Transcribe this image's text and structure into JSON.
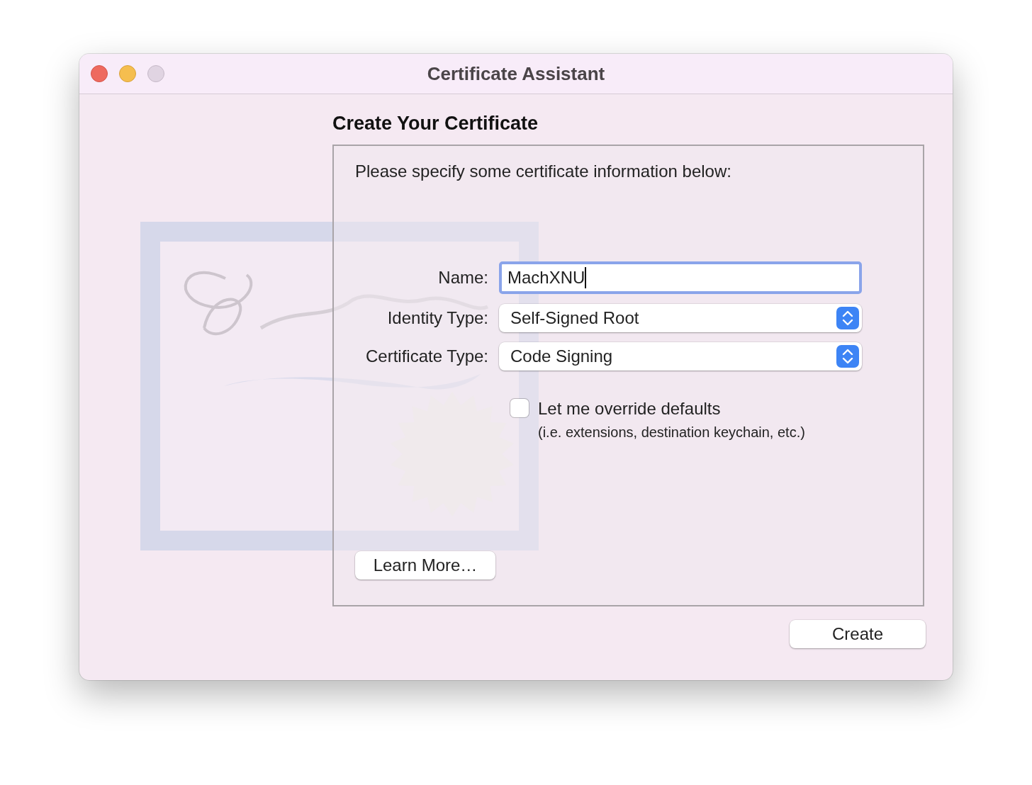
{
  "window": {
    "title": "Certificate Assistant"
  },
  "heading": "Create Your Certificate",
  "panel": {
    "instruction": "Please specify some certificate information below:",
    "fields": [
      {
        "kind": "text",
        "label": "Name:",
        "value": "MachXNU",
        "focused": true
      },
      {
        "kind": "popup",
        "label": "Identity Type:",
        "value": "Self-Signed Root"
      },
      {
        "kind": "popup",
        "label": "Certificate Type:",
        "value": "Code Signing"
      }
    ],
    "override": {
      "label": "Let me override defaults",
      "note": "(i.e. extensions, destination keychain, etc.)",
      "checked": false
    },
    "learn_more": "Learn More…"
  },
  "buttons": {
    "create": "Create"
  }
}
